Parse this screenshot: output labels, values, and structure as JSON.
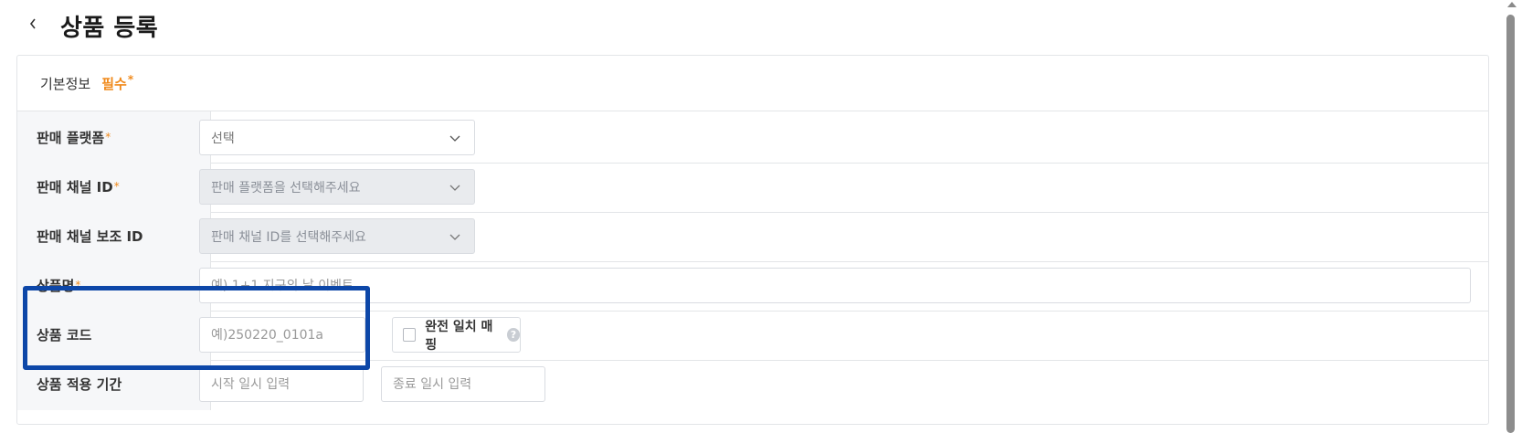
{
  "header": {
    "back_icon": "chevron-left-icon",
    "title": "상품 등록"
  },
  "section": {
    "title": "기본정보",
    "required_label": "필수",
    "required_star": "*"
  },
  "rows": {
    "platform": {
      "label": "판매 플랫폼",
      "star": "*",
      "value": "선택"
    },
    "channel_id": {
      "label": "판매 채널 ID",
      "star": "*",
      "placeholder": "판매 플랫폼을 선택해주세요"
    },
    "sub_channel_id": {
      "label": "판매 채널 보조 ID",
      "placeholder": "판매 채널 ID를 선택해주세요"
    },
    "product_name": {
      "label": "상품명",
      "star": "*",
      "placeholder": "예) 1+1 지구의 날 이벤트"
    },
    "product_code": {
      "label": "상품 코드",
      "placeholder": "예)250220_0101a",
      "exact_match_label": "완전 일치 매핑",
      "help_icon": "?"
    },
    "period": {
      "label": "상품 적용 기간",
      "start_placeholder": "시작 일시 입력",
      "separator": "~",
      "end_placeholder": "종료 일시 입력"
    }
  },
  "colors": {
    "accent": "#f08a1c",
    "highlight": "#0d47a8",
    "label_bg": "#f6f7f9",
    "disabled_bg": "#e9ebee"
  }
}
